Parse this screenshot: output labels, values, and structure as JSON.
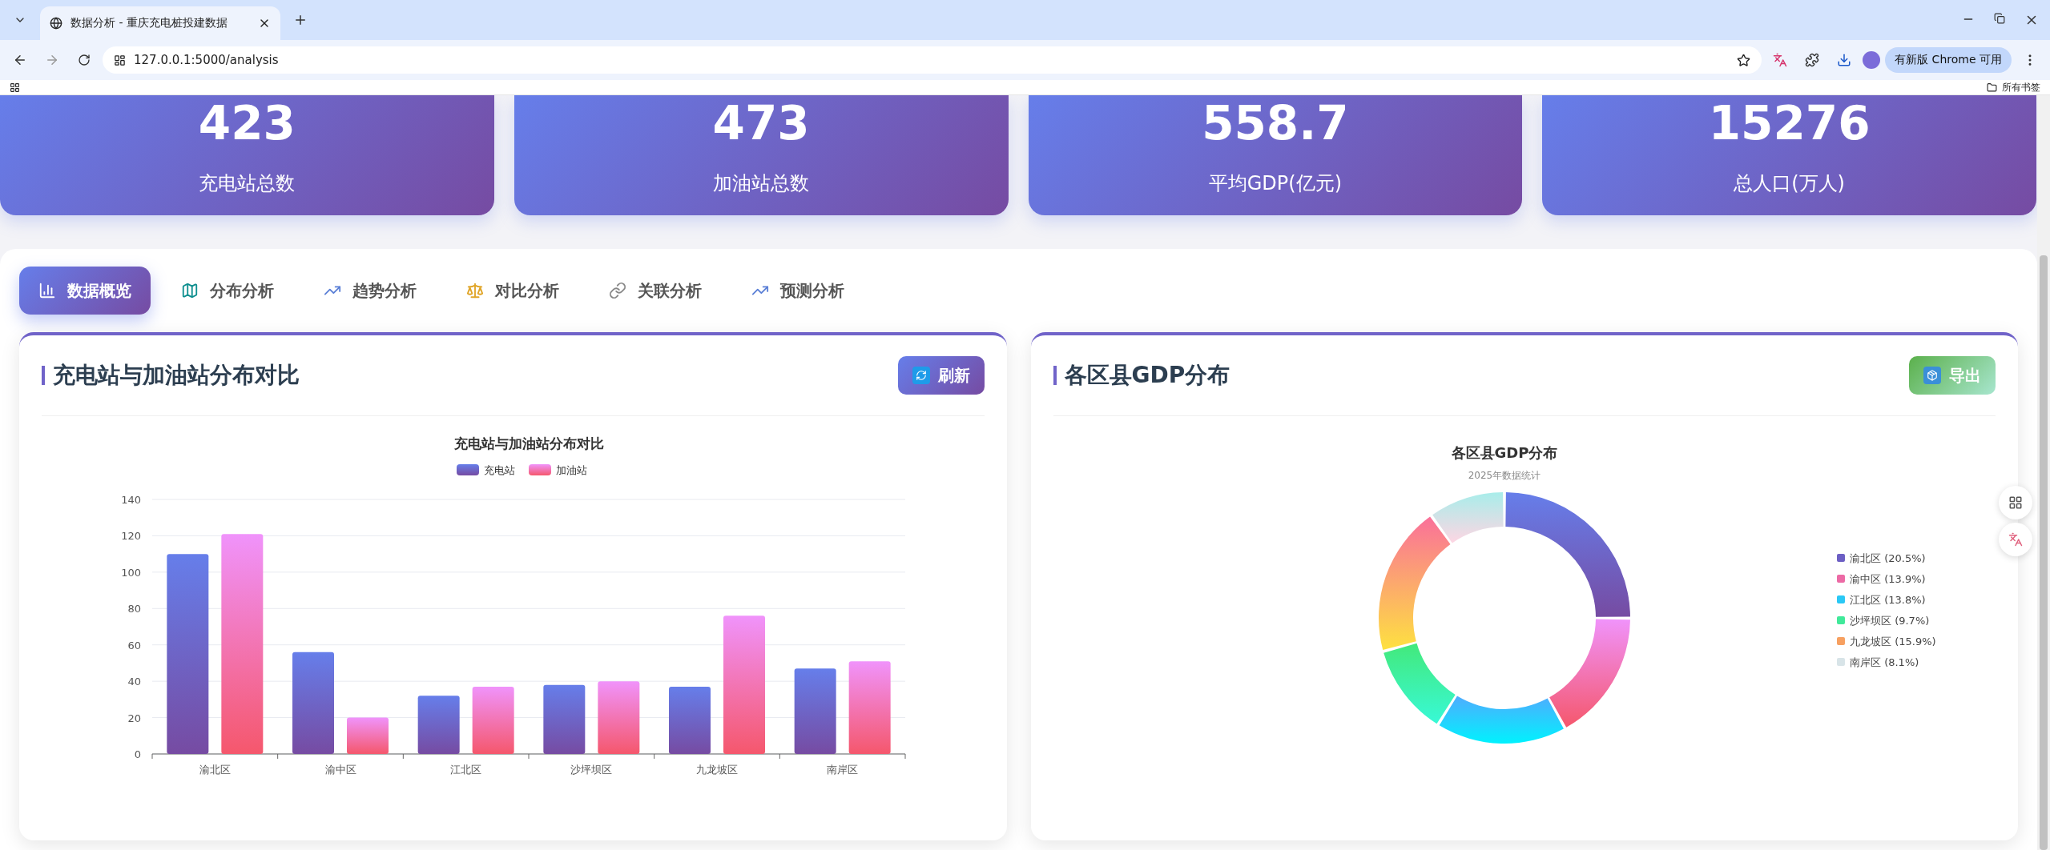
{
  "browser": {
    "tab_title": "数据分析 - 重庆充电桩投建数据",
    "url": "127.0.0.1:5000/analysis",
    "update_button": "有新版 Chrome 可用",
    "bookmarks_folder": "所有书签"
  },
  "stats": [
    {
      "value": "423",
      "label": "充电站总数"
    },
    {
      "value": "473",
      "label": "加油站总数"
    },
    {
      "value": "558.7",
      "label": "平均GDP(亿元)"
    },
    {
      "value": "15276",
      "label": "总人口(万人)"
    }
  ],
  "tabs": [
    {
      "label": "数据概览",
      "kind": "overview",
      "selected": true
    },
    {
      "label": "分布分析",
      "kind": "map",
      "selected": false
    },
    {
      "label": "趋势分析",
      "kind": "trend",
      "selected": false
    },
    {
      "label": "对比分析",
      "kind": "compare",
      "selected": false
    },
    {
      "label": "关联分析",
      "kind": "link",
      "selected": false
    },
    {
      "label": "预测分析",
      "kind": "trend",
      "selected": false
    }
  ],
  "bar_card": {
    "title": "充电站与加油站分布对比",
    "button": "刷新",
    "chart_data": {
      "type": "bar",
      "grid": true,
      "legend": "top",
      "title": "充电站与加油站分布对比",
      "categories": [
        "渝北区",
        "渝中区",
        "江北区",
        "沙坪坝区",
        "九龙坡区",
        "南岸区"
      ],
      "ylim": [
        0,
        140
      ],
      "yticks": [
        0,
        20,
        40,
        60,
        80,
        100,
        120,
        140
      ],
      "series": [
        {
          "name": "充电站",
          "color": "#667eea",
          "values": [
            110,
            56,
            32,
            38,
            37,
            47
          ]
        },
        {
          "name": "加油站",
          "color": "#f093fb",
          "values": [
            121,
            20,
            37,
            40,
            76,
            51
          ]
        }
      ]
    }
  },
  "donut_card": {
    "title": "各区县GDP分布",
    "button": "导出",
    "subtitle": "2025年数据统计",
    "chart_data": {
      "type": "donut",
      "title": "各区县GDP分布",
      "legend": "right",
      "categories": [
        "渝北区 (20.5%)",
        "渝中区 (13.9%)",
        "江北区 (13.8%)",
        "沙坪坝区 (9.7%)",
        "九龙坡区 (15.9%)",
        "南岸区 (8.1%)"
      ],
      "values": [
        20.5,
        13.9,
        13.8,
        9.7,
        15.9,
        8.1
      ]
    },
    "legend": [
      {
        "color": "#6c5fc4"
      },
      {
        "color": "#ec6aa5"
      },
      {
        "color": "#2ac8f5"
      },
      {
        "color": "#40e99a"
      },
      {
        "color": "#f7a060"
      },
      {
        "color": "#d8e4e8"
      }
    ]
  }
}
